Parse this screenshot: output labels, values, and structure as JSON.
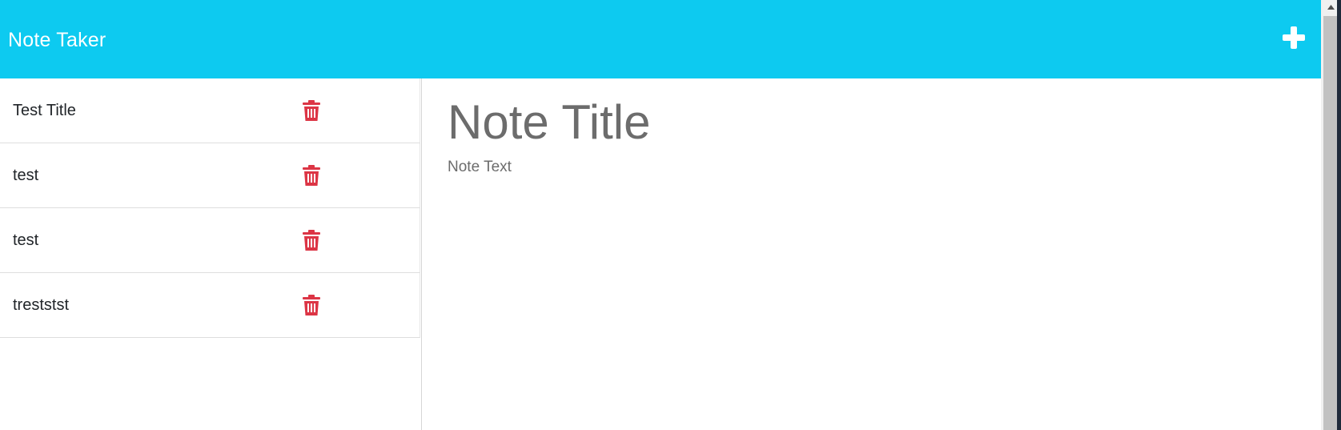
{
  "app": {
    "title": "Note Taker"
  },
  "toolbar": {
    "new_note_icon": "plus-icon"
  },
  "notes": [
    {
      "title": "Test Title",
      "delete_icon": "trash-icon"
    },
    {
      "title": "test",
      "delete_icon": "trash-icon"
    },
    {
      "title": "test",
      "delete_icon": "trash-icon"
    },
    {
      "title": "treststst",
      "delete_icon": "trash-icon"
    }
  ],
  "editor": {
    "title_placeholder": "Note Title",
    "text_placeholder": "Note Text"
  },
  "colors": {
    "navbar": "#0dcaf0",
    "delete": "#dc3545",
    "placeholder": "#6c6c6c"
  }
}
